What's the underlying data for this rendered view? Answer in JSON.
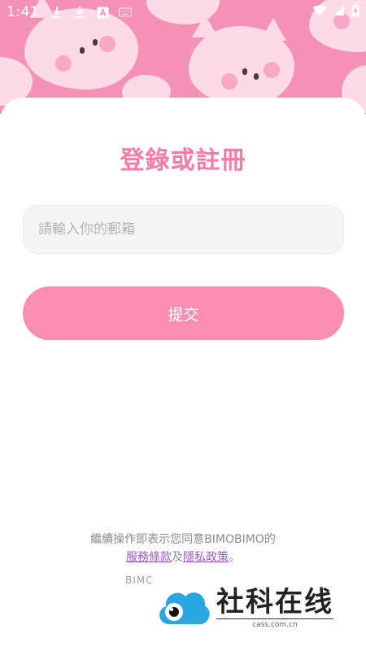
{
  "status_bar": {
    "time": "1:41",
    "notification_icons": [
      "download-icon",
      "download-icon",
      "text-a-icon",
      "keyboard-icon"
    ],
    "system_icons": [
      "wifi-icon",
      "signal-icon",
      "battery-charging-icon"
    ]
  },
  "header": {
    "title": "登錄或註冊"
  },
  "form": {
    "email_placeholder": "請輸入你的郵箱",
    "email_value": "",
    "submit_label": "提交"
  },
  "agreement": {
    "prefix": "繼續操作即表示您同意BIMOBIMO的",
    "terms_link": "服務條款",
    "conjunction": "及",
    "privacy_link": "隱私政策",
    "suffix": "。"
  },
  "version_text": "BIMC",
  "watermark": {
    "name": "社科在线",
    "url": "cass.com.cn"
  },
  "colors": {
    "hero_background": "#f591b6",
    "title_pink": "#f77ca5",
    "button_pink": "#f98eb2",
    "link_purple": "#9b59c9"
  }
}
